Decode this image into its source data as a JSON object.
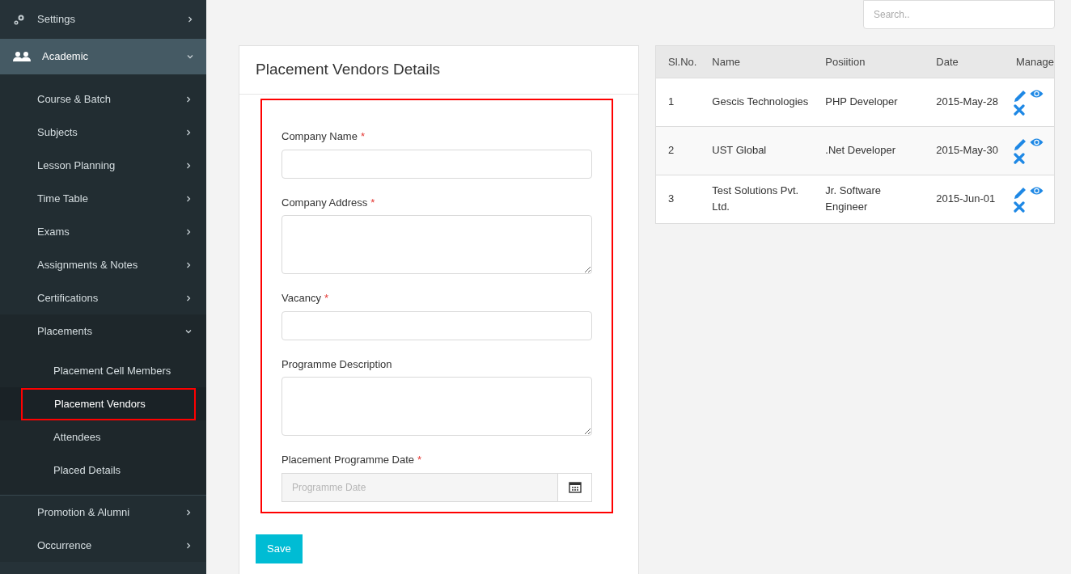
{
  "sidebar": {
    "items": [
      {
        "label": "Settings",
        "expanded": false
      },
      {
        "label": "Academic",
        "expanded": true,
        "children": [
          {
            "label": "Course & Batch",
            "expanded": false
          },
          {
            "label": "Subjects",
            "expanded": false
          },
          {
            "label": "Lesson Planning",
            "expanded": false
          },
          {
            "label": "Time Table",
            "expanded": false
          },
          {
            "label": "Exams",
            "expanded": false
          },
          {
            "label": "Assignments & Notes",
            "expanded": false
          },
          {
            "label": "Certifications",
            "expanded": false
          },
          {
            "label": "Placements",
            "expanded": true,
            "children": [
              {
                "label": "Placement Cell Members",
                "selected": false,
                "highlighted": false
              },
              {
                "label": "Placement Vendors",
                "selected": true,
                "highlighted": true
              },
              {
                "label": "Attendees",
                "selected": false,
                "highlighted": false
              },
              {
                "label": "Placed Details",
                "selected": false,
                "highlighted": false
              }
            ]
          },
          {
            "label": "Promotion & Alumni",
            "expanded": false
          },
          {
            "label": "Occurrence",
            "expanded": false
          }
        ]
      }
    ]
  },
  "search": {
    "placeholder": "Search.."
  },
  "form": {
    "title": "Placement Vendors Details",
    "highlighted": true,
    "fields": [
      {
        "kind": "input",
        "label": "Company Name",
        "required_mark": "*"
      },
      {
        "kind": "textarea",
        "label": "Company Address",
        "required_mark": "*"
      },
      {
        "kind": "input",
        "label": "Vacancy",
        "required_mark": "*"
      },
      {
        "kind": "textarea",
        "label": "Programme Description"
      },
      {
        "kind": "date",
        "label": "Placement Programme Date",
        "required_mark": "*",
        "placeholder": "Programme Date"
      }
    ],
    "save_button": "Save"
  },
  "table": {
    "columns": [
      "Sl.No.",
      "Name",
      "Posiition",
      "Date",
      "Manage"
    ],
    "rows": [
      {
        "cells": [
          "1",
          "Gescis Technologies",
          "PHP Developer",
          "2015-May-28"
        ]
      },
      {
        "cells": [
          "2",
          "UST Global",
          ".Net Developer",
          "2015-May-30"
        ]
      },
      {
        "cells": [
          "3",
          "Test Solutions Pvt. Ltd.",
          "Jr. Software Engineer",
          "2015-Jun-01"
        ]
      }
    ]
  }
}
